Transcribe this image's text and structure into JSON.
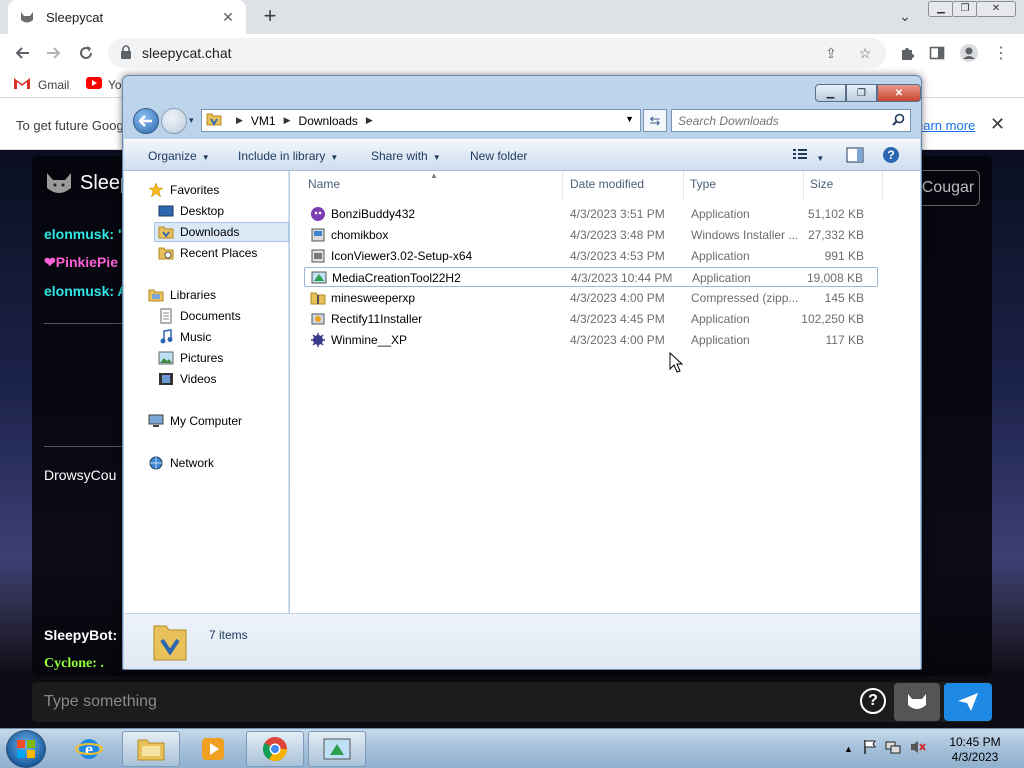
{
  "browser": {
    "tab_title": "Sleepycat",
    "url": "sleepycat.chat",
    "bookmarks": [
      {
        "label": "Gmail",
        "icon": "gmail-icon"
      },
      {
        "label": "Yo",
        "icon": "youtube-icon"
      }
    ],
    "infobar_text": "To get future Goog",
    "infobar_link": "earn more"
  },
  "sleepycat": {
    "brand": "Sleep",
    "cougar_button": "Cougar",
    "chat": [
      {
        "name": "elonmusk: \"I",
        "color": "#2ee6e6"
      },
      {
        "name": "❤PinkiePie",
        "color": "#ff5fd7"
      },
      {
        "name": "elonmusk: An",
        "color": "#2ee6e6"
      },
      {
        "name": "DrowsyCou",
        "color": "#ffffff"
      },
      {
        "name": "SleepyBot:",
        "color": "#ffffff"
      },
      {
        "name": "Cyclone: .",
        "color": "#8fff3a"
      }
    ],
    "input_placeholder": "Type something"
  },
  "explorer": {
    "breadcrumb": [
      "VM1",
      "Downloads"
    ],
    "search_placeholder": "Search Downloads",
    "commands": [
      "Organize",
      "Include in library",
      "Share with",
      "New folder"
    ],
    "nav": {
      "favorites_header": "Favorites",
      "favorites": [
        "Desktop",
        "Downloads",
        "Recent Places"
      ],
      "libraries_header": "Libraries",
      "libraries": [
        "Documents",
        "Music",
        "Pictures",
        "Videos"
      ],
      "computer": "My Computer",
      "network": "Network"
    },
    "columns": [
      "Name",
      "Date modified",
      "Type",
      "Size"
    ],
    "files": [
      {
        "name": "BonziBuddy432",
        "date": "4/3/2023 3:51 PM",
        "type": "Application",
        "size": "51,102 KB",
        "icon": "bonzi-icon"
      },
      {
        "name": "chomikbox",
        "date": "4/3/2023 3:48 PM",
        "type": "Windows Installer ...",
        "size": "27,332 KB",
        "icon": "installer-icon"
      },
      {
        "name": "IconViewer3.02-Setup-x64",
        "date": "4/3/2023 4:53 PM",
        "type": "Application",
        "size": "991 KB",
        "icon": "setup-icon"
      },
      {
        "name": "MediaCreationTool22H2",
        "date": "4/3/2023 10:44 PM",
        "type": "Application",
        "size": "19,008 KB",
        "icon": "media-tool-icon"
      },
      {
        "name": "minesweeperxp",
        "date": "4/3/2023 4:00 PM",
        "type": "Compressed (zipp...",
        "size": "145 KB",
        "icon": "zip-folder-icon"
      },
      {
        "name": "Rectify11Installer",
        "date": "4/3/2023 4:45 PM",
        "type": "Application",
        "size": "102,250 KB",
        "icon": "installer-app-icon"
      },
      {
        "name": "Winmine__XP",
        "date": "4/3/2023 4:00 PM",
        "type": "Application",
        "size": "117 KB",
        "icon": "mine-icon"
      }
    ],
    "item_count": "7 items"
  },
  "taskbar": {
    "time": "10:45 PM",
    "date": "4/3/2023"
  }
}
